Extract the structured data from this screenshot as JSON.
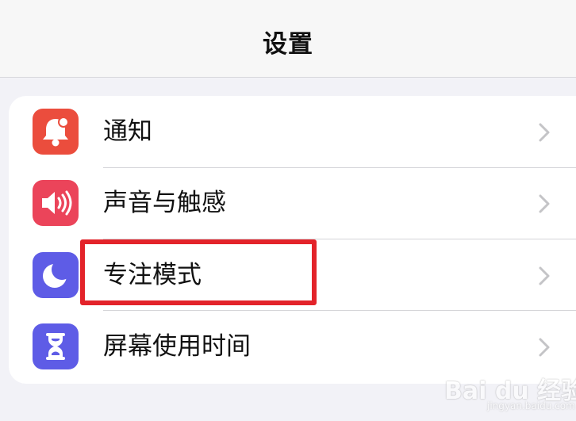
{
  "nav": {
    "title": "设置"
  },
  "settings": {
    "items": [
      {
        "label": "通知",
        "icon": "bell-badge-icon",
        "icon_color": "#eb4d3d"
      },
      {
        "label": "声音与触感",
        "icon": "speaker-wave-icon",
        "icon_color": "#eb445a"
      },
      {
        "label": "专注模式",
        "icon": "moon-icon",
        "icon_color": "#5e5ce6"
      },
      {
        "label": "屏幕使用时间",
        "icon": "hourglass-icon",
        "icon_color": "#5e5ce6"
      }
    ]
  },
  "highlight": {
    "color": "#e3232a",
    "target": "专注模式"
  },
  "watermark": {
    "brand": "Bai du 经验",
    "url": "jingyan.baidu.com"
  }
}
